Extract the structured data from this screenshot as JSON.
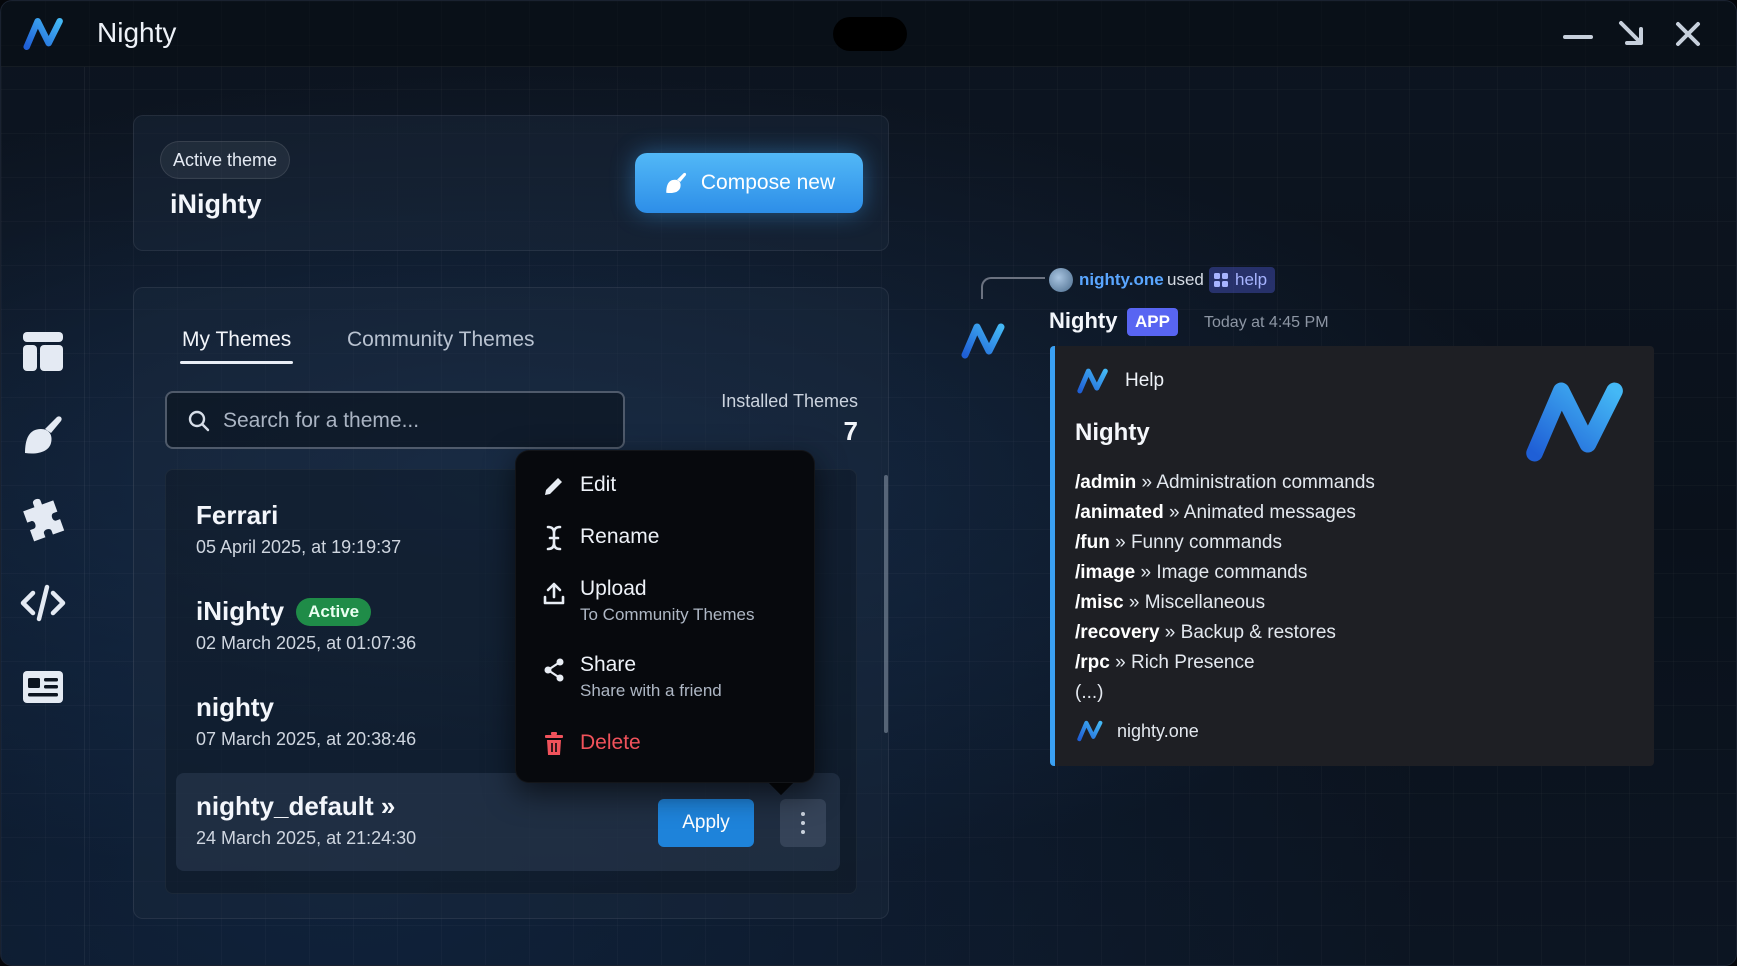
{
  "app": {
    "title": "Nighty"
  },
  "colors": {
    "accent": "#2d8ee8",
    "active_badge": "#1f8c48",
    "delete": "#f0525b",
    "embed_bar": "#3aa0f3",
    "app_badge": "#5865f2"
  },
  "sidebar": {
    "items": [
      {
        "icon": "layout-icon"
      },
      {
        "icon": "paint-icon"
      },
      {
        "icon": "puzzle-icon"
      },
      {
        "icon": "code-icon"
      },
      {
        "icon": "id-card-icon"
      }
    ]
  },
  "active_theme": {
    "label": "Active theme",
    "name": "iNighty",
    "compose_label": "Compose new"
  },
  "tabs": [
    {
      "label": "My Themes",
      "selected": true
    },
    {
      "label": "Community Themes",
      "selected": false
    }
  ],
  "search": {
    "placeholder": "Search for a theme..."
  },
  "installed": {
    "label": "Installed Themes",
    "count": "7"
  },
  "themes": [
    {
      "name": "Ferrari",
      "date": "05 April 2025, at 19:19:37"
    },
    {
      "name": "iNighty",
      "date": "02 March 2025, at 01:07:36",
      "badge": "Active"
    },
    {
      "name": "nighty",
      "date": "07 March 2025, at 20:38:46"
    },
    {
      "name": "nighty_default »",
      "date": "24 March 2025, at 21:24:30",
      "apply_label": "Apply"
    }
  ],
  "context_menu": {
    "items": [
      {
        "label": "Edit",
        "icon": "pencil-icon"
      },
      {
        "label": "Rename",
        "icon": "text-cursor-icon"
      },
      {
        "label": "Upload",
        "sub": "To Community Themes",
        "icon": "upload-icon"
      },
      {
        "label": "Share",
        "sub": "Share with a friend",
        "icon": "share-icon"
      },
      {
        "label": "Delete",
        "icon": "trash-icon"
      }
    ]
  },
  "preview": {
    "reply_user": "nighty.one",
    "reply_used": "used",
    "reply_command": "help",
    "bot_name": "Nighty",
    "app_badge": "APP",
    "timestamp": "Today at 4:45 PM",
    "embed": {
      "author": "Help",
      "title": "Nighty",
      "commands": [
        {
          "cmd": "/admin",
          "desc": "» Administration commands"
        },
        {
          "cmd": "/animated",
          "desc": "» Animated messages"
        },
        {
          "cmd": "/fun",
          "desc": "» Funny commands"
        },
        {
          "cmd": "/image",
          "desc": "» Image commands"
        },
        {
          "cmd": "/misc",
          "desc": "» Miscellaneous"
        },
        {
          "cmd": "/recovery",
          "desc": "» Backup & restores"
        },
        {
          "cmd": "/rpc",
          "desc": "» Rich Presence"
        }
      ],
      "more": "(...)",
      "footer": "nighty.one"
    }
  }
}
